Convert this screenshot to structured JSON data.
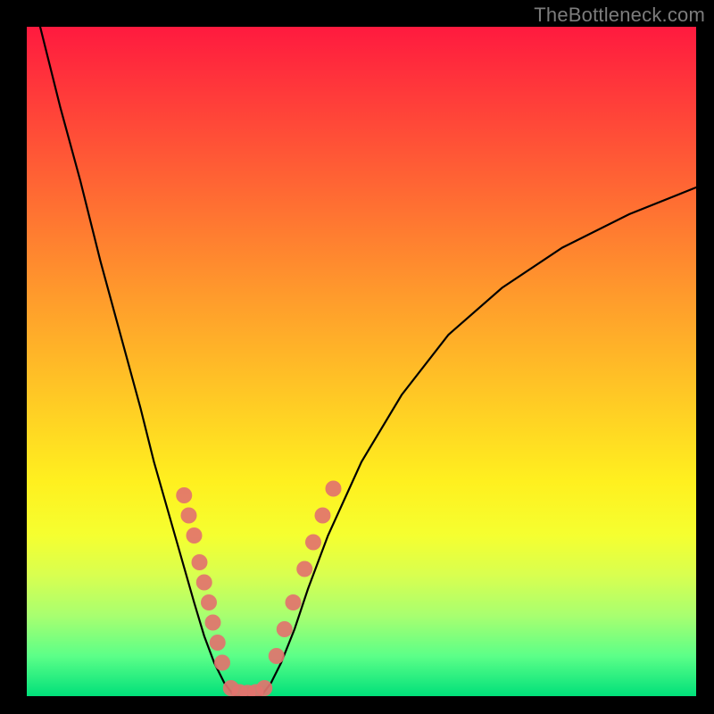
{
  "attribution": "TheBottleneck.com",
  "chart_data": {
    "type": "line",
    "title": "",
    "xlabel": "",
    "ylabel": "",
    "xlim": [
      0,
      100
    ],
    "ylim": [
      0,
      100
    ],
    "grid": false,
    "legend": false,
    "series": [
      {
        "name": "left-branch",
        "x": [
          2,
          5,
          8,
          11,
          14,
          17,
          19,
          21,
          23,
          25,
          26.5,
          28,
          29.5,
          31
        ],
        "y": [
          100,
          88,
          77,
          65,
          54,
          43,
          35,
          28,
          21,
          14,
          9,
          5,
          2,
          0
        ],
        "color": "#000000"
      },
      {
        "name": "right-branch",
        "x": [
          35,
          36.5,
          38,
          40,
          42,
          45,
          50,
          56,
          63,
          71,
          80,
          90,
          100
        ],
        "y": [
          0,
          2,
          5,
          10,
          16,
          24,
          35,
          45,
          54,
          61,
          67,
          72,
          76
        ],
        "color": "#000000"
      },
      {
        "name": "valley-floor",
        "x": [
          31,
          32,
          33,
          34,
          35
        ],
        "y": [
          0,
          0,
          0,
          0,
          0
        ],
        "color": "#000000"
      }
    ],
    "markers": {
      "name": "highlighted-points",
      "color": "#e2736e",
      "radius_px": 9,
      "points": [
        {
          "x": 23.5,
          "y": 30
        },
        {
          "x": 24.2,
          "y": 27
        },
        {
          "x": 25.0,
          "y": 24
        },
        {
          "x": 25.8,
          "y": 20
        },
        {
          "x": 26.5,
          "y": 17
        },
        {
          "x": 27.2,
          "y": 14
        },
        {
          "x": 27.8,
          "y": 11
        },
        {
          "x": 28.5,
          "y": 8
        },
        {
          "x": 29.2,
          "y": 5
        },
        {
          "x": 30.5,
          "y": 1.2
        },
        {
          "x": 31.8,
          "y": 0.6
        },
        {
          "x": 33.0,
          "y": 0.5
        },
        {
          "x": 34.2,
          "y": 0.6
        },
        {
          "x": 35.5,
          "y": 1.2
        },
        {
          "x": 37.3,
          "y": 6
        },
        {
          "x": 38.5,
          "y": 10
        },
        {
          "x": 39.8,
          "y": 14
        },
        {
          "x": 41.5,
          "y": 19
        },
        {
          "x": 42.8,
          "y": 23
        },
        {
          "x": 44.2,
          "y": 27
        },
        {
          "x": 45.8,
          "y": 31
        }
      ]
    }
  }
}
